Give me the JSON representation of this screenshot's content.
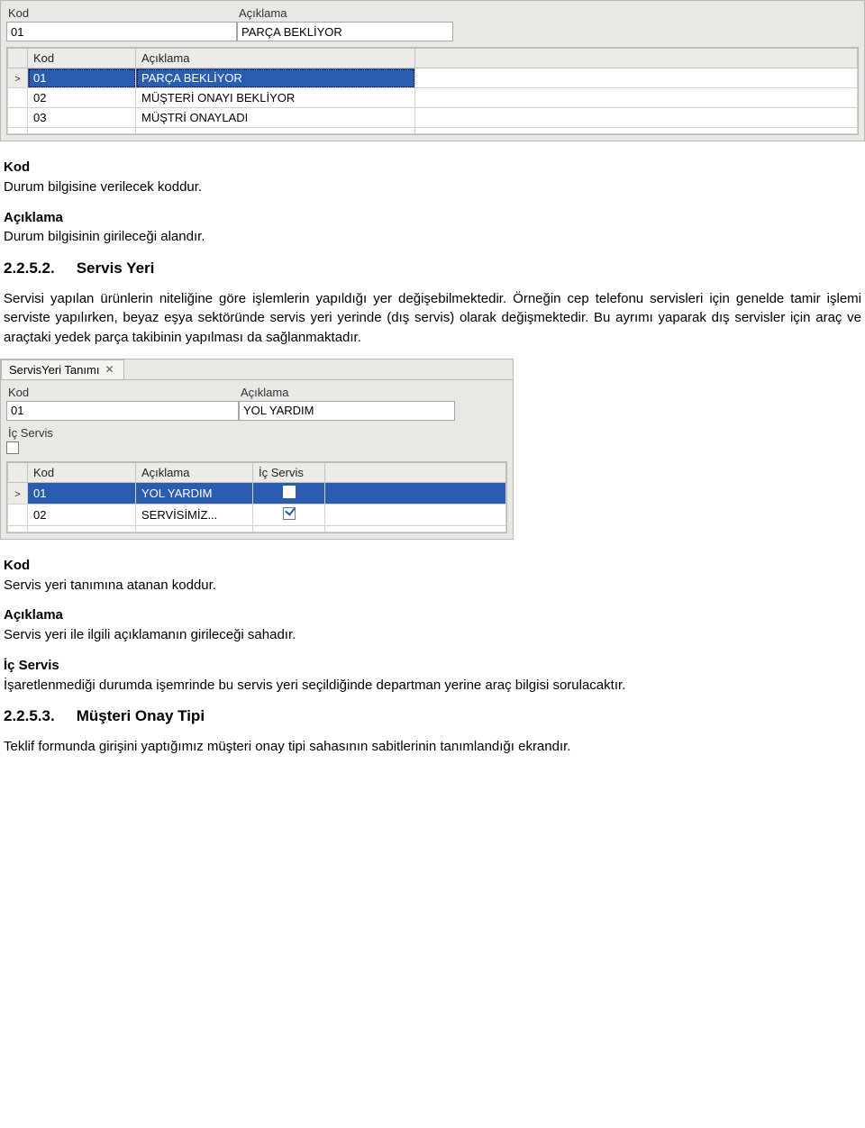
{
  "panel1": {
    "kod_label": "Kod",
    "aciklama_label": "Açıklama",
    "kod_value": "01",
    "aciklama_value": "PARÇA BEKLİYOR",
    "grid_headers": {
      "kod": "Kod",
      "aciklama": "Açıklama"
    },
    "rows": [
      {
        "kod": "01",
        "aciklama": "PARÇA BEKLİYOR"
      },
      {
        "kod": "02",
        "aciklama": "MÜŞTERİ ONAYI BEKLİYOR"
      },
      {
        "kod": "03",
        "aciklama": "MÜŞTRİ ONAYLADI"
      }
    ]
  },
  "doc1": {
    "kod_term": "Kod",
    "kod_desc": "Durum bilgisine verilecek koddur.",
    "aciklama_term": "Açıklama",
    "aciklama_desc": "Durum bilgisinin girileceği alandır.",
    "sec_num": "2.2.5.2.",
    "sec_title": "Servis Yeri",
    "para": "Servisi yapılan ürünlerin niteliğine göre işlemlerin yapıldığı yer değişebilmektedir. Örneğin cep telefonu servisleri için genelde tamir işlemi serviste yapılırken, beyaz eşya sektöründe servis yeri yerinde (dış servis) olarak değişmektedir. Bu ayrımı yaparak dış servisler için araç ve araçtaki yedek parça takibinin yapılması da sağlanmaktadır."
  },
  "panel2": {
    "tab_label": "ServisYeri Tanımı",
    "kod_label": "Kod",
    "aciklama_label": "Açıklama",
    "kod_value": "01",
    "aciklama_value": "YOL YARDIM",
    "icservis_label": "İç Servis",
    "grid_headers": {
      "kod": "Kod",
      "aciklama": "Açıklama",
      "ic": "İç Servis"
    },
    "rows": [
      {
        "kod": "01",
        "aciklama": "YOL YARDIM",
        "ic": false
      },
      {
        "kod": "02",
        "aciklama": "SERVİSİMİZ...",
        "ic": true
      }
    ]
  },
  "doc2": {
    "kod_term": "Kod",
    "kod_desc": "Servis yeri tanımına atanan koddur.",
    "aciklama_term": "Açıklama",
    "aciklama_desc": "Servis yeri ile ilgili açıklamanın girileceği sahadır.",
    "ic_term": "İç Servis",
    "ic_desc": "İşaretlenmediği durumda işemrinde bu servis yeri seçildiğinde departman yerine araç bilgisi sorulacaktır.",
    "sec_num": "2.2.5.3.",
    "sec_title": "Müşteri Onay Tipi",
    "para": "Teklif formunda girişini yaptığımız müşteri onay tipi sahasının sabitlerinin tanımlandığı ekrandır."
  }
}
